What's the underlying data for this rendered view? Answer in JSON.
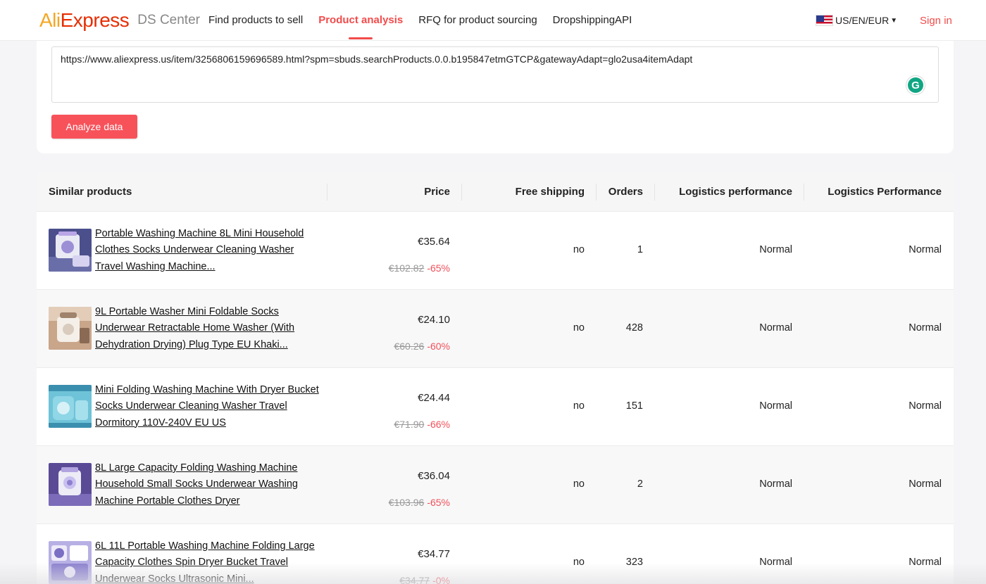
{
  "header": {
    "logo_ali": "Ali",
    "logo_express": "Express",
    "ds_center": "DS Center",
    "nav": [
      {
        "label": "Find products to sell"
      },
      {
        "label": "Product analysis"
      },
      {
        "label": "RFQ for product sourcing"
      },
      {
        "label": "DropshippingAPI"
      }
    ],
    "locale": "US/EN/EUR",
    "sign_in": "Sign in"
  },
  "url_input": {
    "value": "https://www.aliexpress.us/item/3256806159696589.html?spm=sbuds.searchProducts.0.0.b195847etmGTCP&gatewayAdapt=glo2usa4itemAdapt"
  },
  "analyze_button": "Analyze data",
  "table": {
    "headers": {
      "product": "Similar products",
      "price": "Price",
      "shipping": "Free shipping",
      "orders": "Orders",
      "logistics1": "Logistics performance",
      "logistics2": "Logistics Performance"
    },
    "rows": [
      {
        "title": "Portable Washing Machine 8L Mini Household Clothes Socks Underwear Cleaning Washer Travel Washing Machine...",
        "price": "€35.64",
        "original": "€102.82",
        "discount": "-65%",
        "shipping": "no",
        "orders": "1",
        "log1": "Normal",
        "log2": "Normal"
      },
      {
        "title": "9L Portable Washer Mini Foldable Socks Underwear Retractable Home Washer (With Dehydration Drying) Plug Type EU Khaki...",
        "price": "€24.10",
        "original": "€60.26",
        "discount": "-60%",
        "shipping": "no",
        "orders": "428",
        "log1": "Normal",
        "log2": "Normal"
      },
      {
        "title": "Mini Folding Washing Machine With Dryer Bucket Socks Underwear Cleaning Washer Travel Dormitory 110V-240V EU US",
        "price": "€24.44",
        "original": "€71.90",
        "discount": "-66%",
        "shipping": "no",
        "orders": "151",
        "log1": "Normal",
        "log2": "Normal"
      },
      {
        "title": "8L Large Capacity Folding Washing Machine Household Small Socks Underwear Washing Machine Portable Clothes Dryer",
        "price": "€36.04",
        "original": "€103.96",
        "discount": "-65%",
        "shipping": "no",
        "orders": "2",
        "log1": "Normal",
        "log2": "Normal"
      },
      {
        "title": "6L 11L Portable Washing Machine Folding Large Capacity Clothes Spin Dryer Bucket Travel Underwear Socks Ultrasonic Mini...",
        "price": "€34.77",
        "original": "€34.77",
        "discount": "-0%",
        "shipping": "no",
        "orders": "323",
        "log1": "Normal",
        "log2": "Normal"
      }
    ]
  },
  "colors": {
    "accent": "#f24b4b",
    "button": "#f7525a",
    "discount": "#f0505a"
  }
}
